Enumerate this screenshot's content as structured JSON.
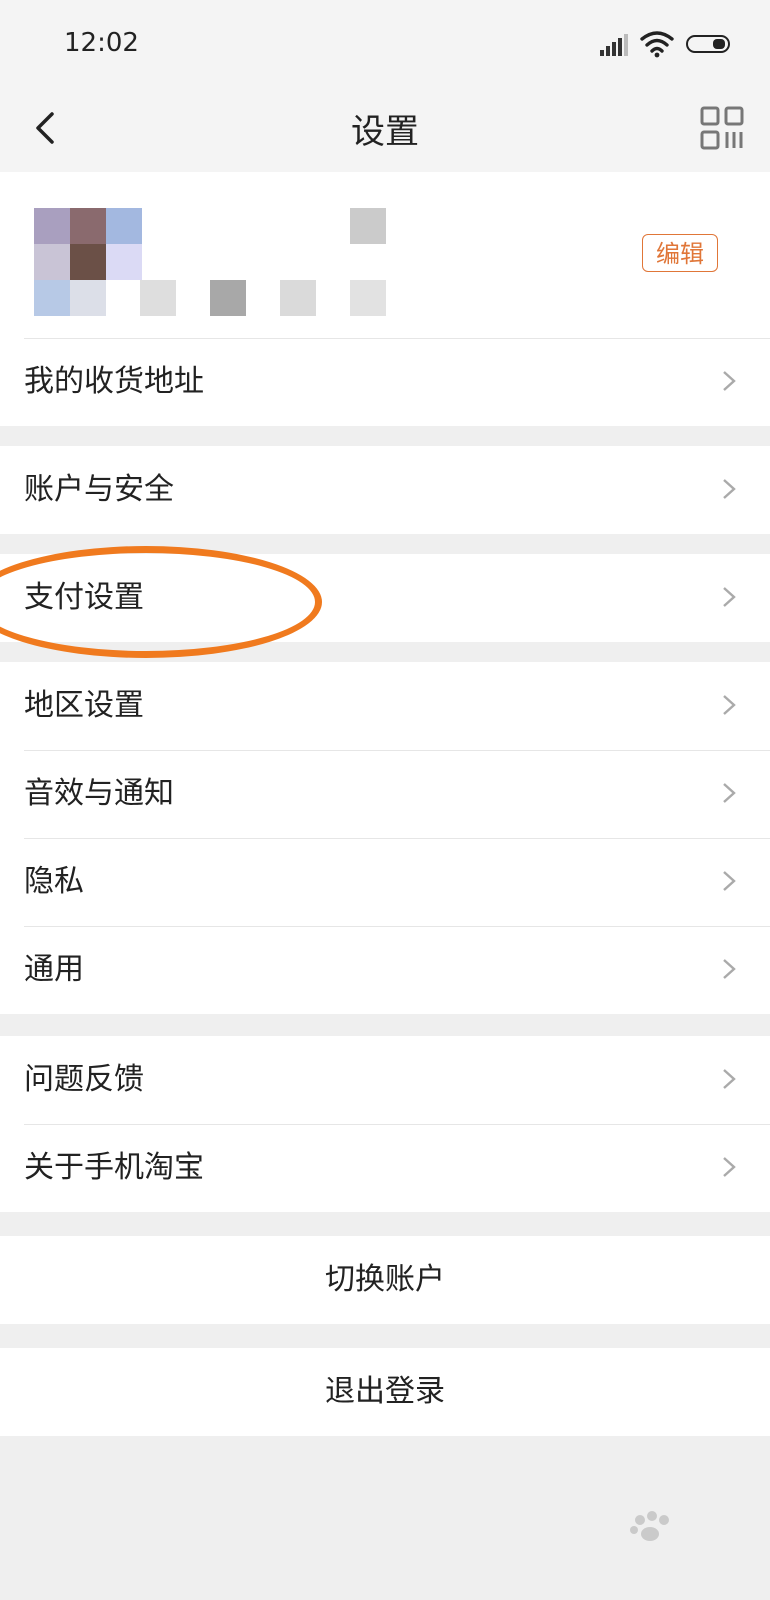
{
  "status_bar": {
    "time": "12:02",
    "icons": [
      "signal-icon",
      "wifi-icon",
      "battery-icon"
    ]
  },
  "nav": {
    "title": "设置",
    "back_icon": "back-chevron-icon",
    "qr_icon": "qr-code-icon"
  },
  "profile": {
    "edit_label": "编辑"
  },
  "groups": [
    {
      "items": [
        {
          "label": "我的收货地址"
        }
      ]
    },
    {
      "items": [
        {
          "label": "账户与安全"
        }
      ]
    },
    {
      "items": [
        {
          "label": "支付设置",
          "highlighted": true
        }
      ]
    },
    {
      "items": [
        {
          "label": "地区设置"
        },
        {
          "label": "音效与通知"
        },
        {
          "label": "隐私"
        },
        {
          "label": "通用"
        }
      ]
    },
    {
      "items": [
        {
          "label": "问题反馈"
        },
        {
          "label": "关于手机淘宝"
        }
      ]
    }
  ],
  "actions": {
    "switch_account": "切换账户",
    "logout": "退出登录"
  },
  "colors": {
    "accent": "#e07638",
    "highlight": "#f07a1e",
    "background": "#efefef"
  }
}
